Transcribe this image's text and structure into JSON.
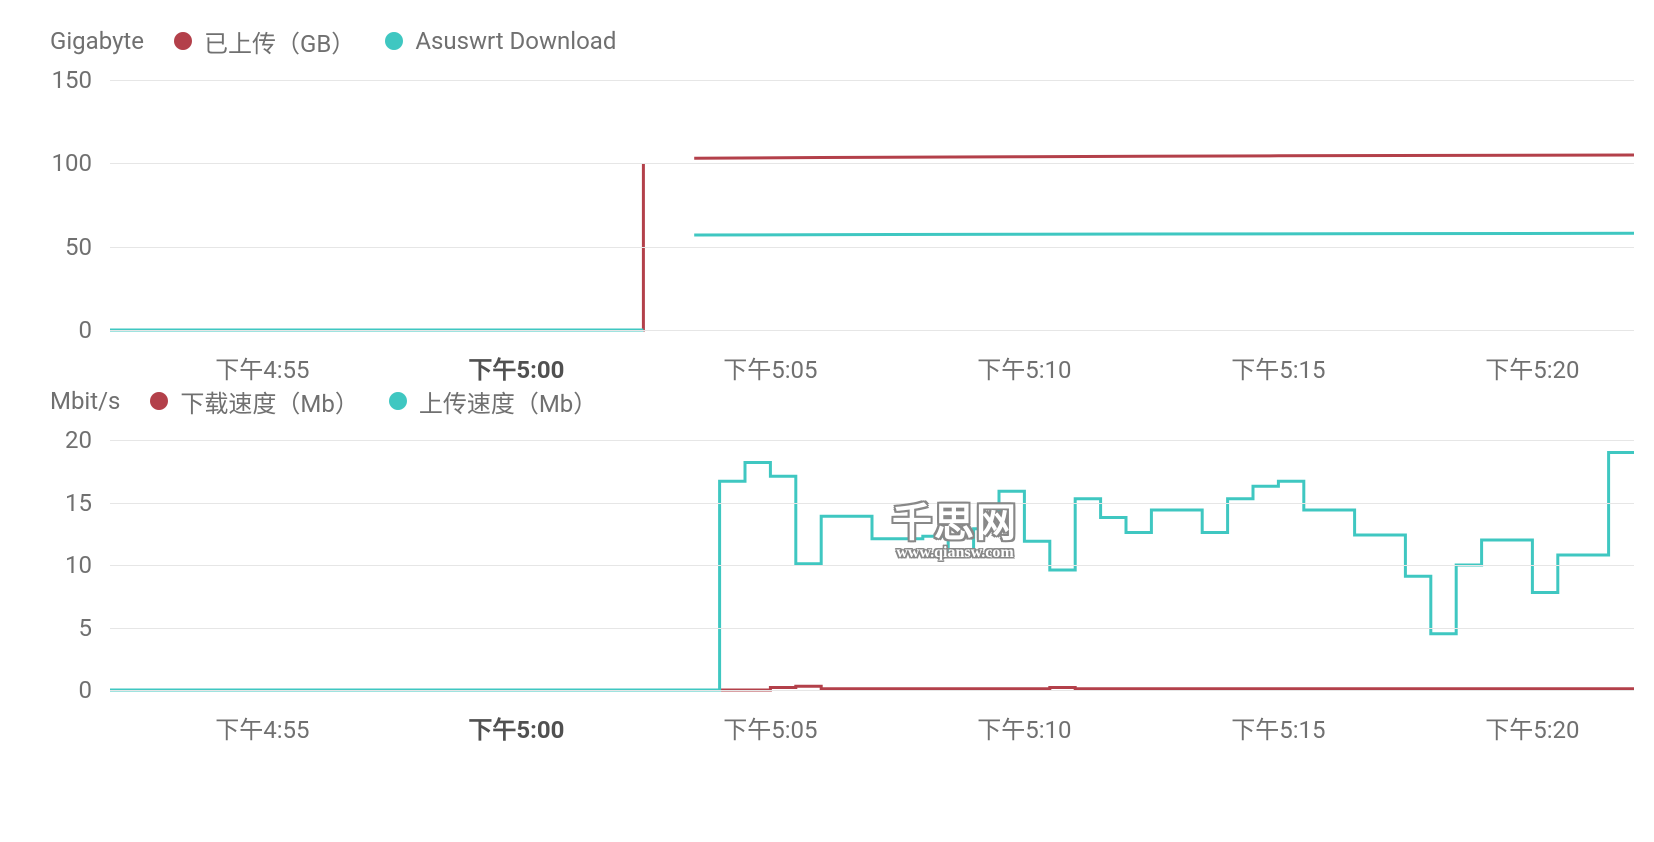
{
  "colors": {
    "red": "#b3404a",
    "teal": "#3fc7c1",
    "grid": "#e6e6e6"
  },
  "watermark": {
    "main": "千思网",
    "sub": "www.qiansw.com"
  },
  "chart_data": [
    {
      "id": "top",
      "type": "line",
      "ytitle": "Gigabyte",
      "ylim": [
        0,
        150
      ],
      "yticks": [
        0,
        50,
        100,
        150
      ],
      "xlabel": "",
      "x_range_minutes": [
        52,
        82
      ],
      "x_ticks": [
        {
          "label": "下午4:55",
          "minute": 55,
          "bold": false
        },
        {
          "label": "下午5:00",
          "minute": 60,
          "bold": true
        },
        {
          "label": "下午5:05",
          "minute": 65,
          "bold": false
        },
        {
          "label": "下午5:10",
          "minute": 70,
          "bold": false
        },
        {
          "label": "下午5:15",
          "minute": 75,
          "bold": false
        },
        {
          "label": "下午5:20",
          "minute": 80,
          "bold": false
        }
      ],
      "series": [
        {
          "name": "已上传（GB）",
          "color_key": "red",
          "points": [
            {
              "minute": 52.0,
              "value": 0
            },
            {
              "minute": 62.5,
              "value": 0
            },
            {
              "minute": 62.5,
              "value": 100
            },
            {
              "minute": 63.0,
              "value": null
            },
            {
              "minute": 63.5,
              "value": 103
            },
            {
              "minute": 66,
              "value": 103.5
            },
            {
              "minute": 70,
              "value": 104
            },
            {
              "minute": 75,
              "value": 104.5
            },
            {
              "minute": 82,
              "value": 105
            }
          ]
        },
        {
          "name": "Asuswrt Download",
          "color_key": "teal",
          "points": [
            {
              "minute": 52.0,
              "value": 0
            },
            {
              "minute": 62.5,
              "value": 0
            },
            {
              "minute": 63.0,
              "value": null
            },
            {
              "minute": 63.5,
              "value": 57
            },
            {
              "minute": 70,
              "value": 57.5
            },
            {
              "minute": 82,
              "value": 58
            }
          ]
        }
      ]
    },
    {
      "id": "bottom",
      "type": "line",
      "step": true,
      "ytitle": "Mbit/s",
      "ylim": [
        0,
        20
      ],
      "yticks": [
        0,
        5,
        10,
        15,
        20
      ],
      "xlabel": "",
      "x_range_minutes": [
        52,
        82
      ],
      "x_ticks": [
        {
          "label": "下午4:55",
          "minute": 55,
          "bold": false
        },
        {
          "label": "下午5:00",
          "minute": 60,
          "bold": true
        },
        {
          "label": "下午5:05",
          "minute": 65,
          "bold": false
        },
        {
          "label": "下午5:10",
          "minute": 70,
          "bold": false
        },
        {
          "label": "下午5:15",
          "minute": 75,
          "bold": false
        },
        {
          "label": "下午5:20",
          "minute": 80,
          "bold": false
        }
      ],
      "series": [
        {
          "name": "下载速度（Mb）",
          "color_key": "red",
          "points": [
            {
              "minute": 52.0,
              "value": 0.0
            },
            {
              "minute": 63.5,
              "value": 0.0
            },
            {
              "minute": 64.0,
              "value": 0.0
            },
            {
              "minute": 65.0,
              "value": 0.2
            },
            {
              "minute": 65.5,
              "value": 0.3
            },
            {
              "minute": 66.0,
              "value": 0.1
            },
            {
              "minute": 70.5,
              "value": 0.2
            },
            {
              "minute": 71.0,
              "value": 0.1
            },
            {
              "minute": 82.0,
              "value": 0.1
            }
          ]
        },
        {
          "name": "上传速度（Mb）",
          "color_key": "teal",
          "points": [
            {
              "minute": 52.0,
              "value": 0.0
            },
            {
              "minute": 63.5,
              "value": 0.0
            },
            {
              "minute": 64.0,
              "value": 16.7
            },
            {
              "minute": 64.5,
              "value": 18.2
            },
            {
              "minute": 65.0,
              "value": 17.1
            },
            {
              "minute": 65.5,
              "value": 10.1
            },
            {
              "minute": 66.0,
              "value": 13.9
            },
            {
              "minute": 66.5,
              "value": 13.9
            },
            {
              "minute": 67.0,
              "value": 12.1
            },
            {
              "minute": 67.5,
              "value": 12.1
            },
            {
              "minute": 68.0,
              "value": 12.3
            },
            {
              "minute": 68.5,
              "value": 11.0
            },
            {
              "minute": 69.0,
              "value": 12.9
            },
            {
              "minute": 69.5,
              "value": 15.9
            },
            {
              "minute": 70.0,
              "value": 11.9
            },
            {
              "minute": 70.5,
              "value": 9.6
            },
            {
              "minute": 71.0,
              "value": 15.3
            },
            {
              "minute": 71.5,
              "value": 13.8
            },
            {
              "minute": 72.0,
              "value": 12.6
            },
            {
              "minute": 72.5,
              "value": 14.4
            },
            {
              "minute": 73.0,
              "value": 14.4
            },
            {
              "minute": 73.5,
              "value": 12.6
            },
            {
              "minute": 74.0,
              "value": 15.3
            },
            {
              "minute": 74.5,
              "value": 16.3
            },
            {
              "minute": 75.0,
              "value": 16.7
            },
            {
              "minute": 75.5,
              "value": 14.4
            },
            {
              "minute": 76.0,
              "value": 14.4
            },
            {
              "minute": 76.5,
              "value": 12.4
            },
            {
              "minute": 77.0,
              "value": 12.4
            },
            {
              "minute": 77.5,
              "value": 9.1
            },
            {
              "minute": 78.0,
              "value": 4.5
            },
            {
              "minute": 78.5,
              "value": 10.0
            },
            {
              "minute": 79.0,
              "value": 12.0
            },
            {
              "minute": 79.5,
              "value": 12.0
            },
            {
              "minute": 80.0,
              "value": 7.8
            },
            {
              "minute": 80.5,
              "value": 10.8
            },
            {
              "minute": 81.0,
              "value": 10.8
            },
            {
              "minute": 81.5,
              "value": 19.0
            },
            {
              "minute": 82.0,
              "value": 19.0
            }
          ]
        }
      ]
    }
  ]
}
